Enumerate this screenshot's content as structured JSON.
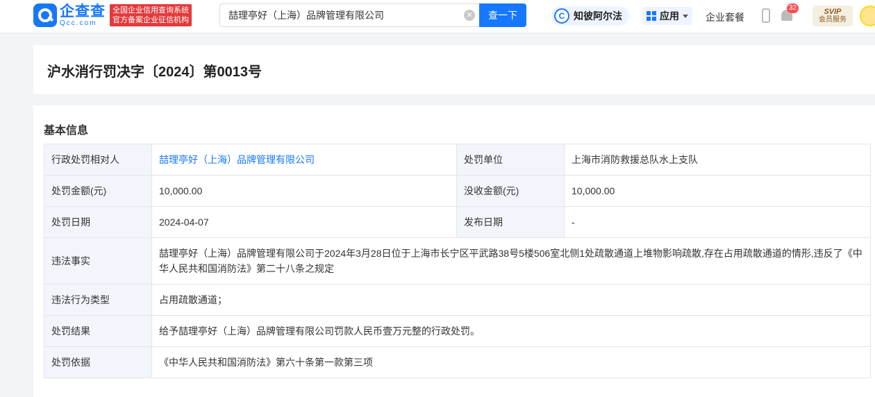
{
  "header": {
    "logo_text": "企查查",
    "logo_sub": "Qcc.com",
    "badge_line1": "全国企业信用查询系统",
    "badge_line2": "官方备案企业征信机构",
    "search_value": "喆理亭好（上海）品牌管理有限公司",
    "search_button": "查一下",
    "zbaef_label": "知彼阿尔法",
    "app_label": "应用",
    "package_label": "企业套餐",
    "notification_count": "32",
    "svip_label": "SVIP",
    "svip_sub": "会员服务"
  },
  "page": {
    "title": "沪水消行罚决字〔2024〕第0013号"
  },
  "section": {
    "title": "基本信息"
  },
  "rows": {
    "party_key": "行政处罚相对人",
    "party_value": "喆理亭好（上海）品牌管理有限公司",
    "unit_key": "处罚单位",
    "unit_value": "上海市消防救援总队水上支队",
    "amount_key": "处罚金额(元)",
    "amount_value": "10,000.00",
    "confiscated_key": "没收金额(元)",
    "confiscated_value": "10,000.00",
    "date_key": "处罚日期",
    "date_value": "2024-04-07",
    "publish_key": "发布日期",
    "publish_value": "-",
    "facts_key": "违法事实",
    "facts_value": "喆理亭好（上海）品牌管理有限公司于2024年3月28日位于上海市长宁区平武路38号5楼506室北侧1处疏散通道上堆物影响疏散,存在占用疏散通道的情形,违反了《中华人民共和国消防法》第二十八条之规定",
    "type_key": "违法行为类型",
    "type_value": "占用疏散通道；",
    "result_key": "处罚结果",
    "result_value": "给予喆理亭好（上海）品牌管理有限公司罚款人民币壹万元整的行政处罚。",
    "basis_key": "处罚依据",
    "basis_value": "《中华人民共和国消防法》第六十条第一款第三项"
  }
}
